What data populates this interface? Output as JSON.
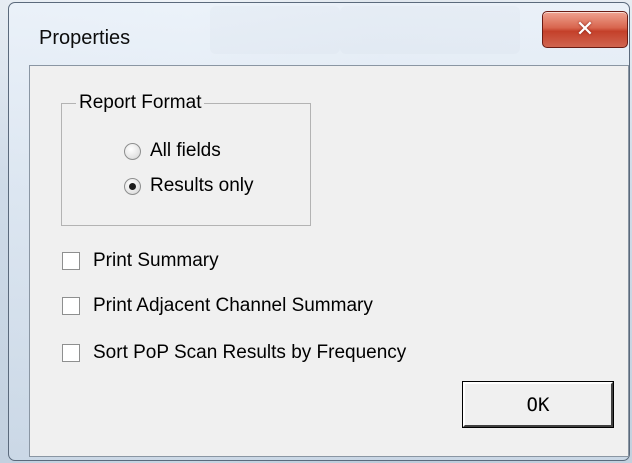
{
  "window": {
    "title": "Properties",
    "close_icon": "close-icon",
    "close_glyph": "✕"
  },
  "report_format": {
    "legend": "Report Format",
    "options": [
      {
        "label": "All fields",
        "selected": false
      },
      {
        "label": "Results only",
        "selected": true
      }
    ]
  },
  "checkboxes": [
    {
      "label": "Print Summary",
      "checked": false
    },
    {
      "label": "Print Adjacent Channel Summary",
      "checked": false
    },
    {
      "label": "Sort PoP Scan Results by Frequency",
      "checked": false
    }
  ],
  "buttons": {
    "ok_label": "OK"
  },
  "colors": {
    "dialog_face": "#f0f0f0",
    "close_button": "#c4402a"
  }
}
